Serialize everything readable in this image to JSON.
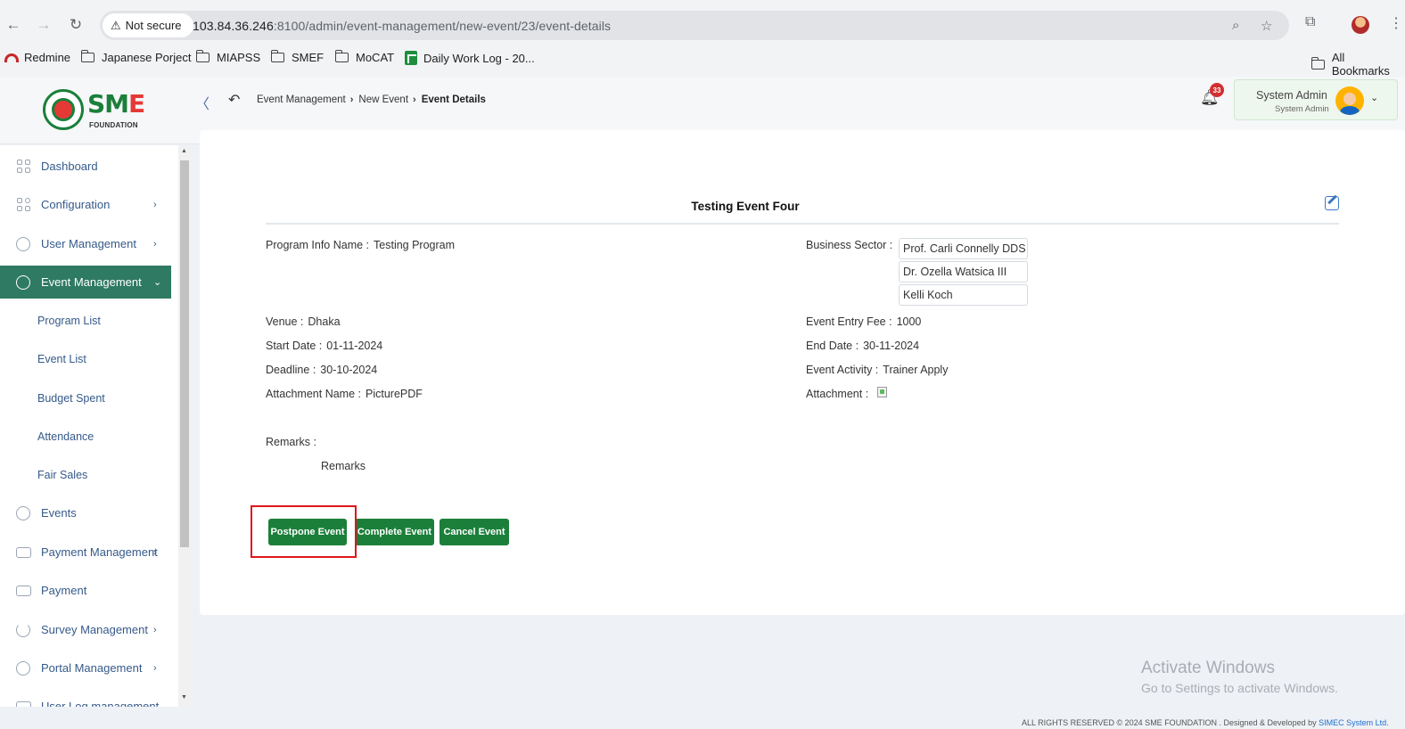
{
  "browser": {
    "security_label": "Not secure",
    "url_host": "103.84.36.246",
    "url_path": ":8100/admin/event-management/new-event/23/event-details",
    "bookmarks": [
      {
        "label": "Redmine",
        "icon": "redmine-icon"
      },
      {
        "label": "Japanese Porject",
        "icon": "folder-icon"
      },
      {
        "label": "MIAPSS",
        "icon": "folder-icon"
      },
      {
        "label": "SMEF",
        "icon": "folder-icon"
      },
      {
        "label": "MoCAT",
        "icon": "folder-icon"
      },
      {
        "label": "Daily Work Log - 20...",
        "icon": "sheets-icon"
      }
    ],
    "all_bookmarks_label": "All Bookmarks"
  },
  "header": {
    "logo_text_sm": "SM",
    "logo_text_e": "E",
    "logo_sub": "FOUNDATION",
    "breadcrumb": [
      "Event Management",
      "New Event",
      "Event Details"
    ],
    "notification_count": "33",
    "user_name": "System Admin",
    "user_role": "System Admin"
  },
  "sidebar": {
    "items": [
      {
        "label": "Dashboard",
        "icon": "dashboard-icon"
      },
      {
        "label": "Configuration",
        "icon": "configuration-icon"
      },
      {
        "label": "User Management",
        "icon": "user-management-icon"
      },
      {
        "label": "Event Management",
        "icon": "event-management-icon"
      },
      {
        "label": "Events",
        "icon": "events-icon"
      },
      {
        "label": "Payment Management",
        "icon": "payment-management-icon"
      },
      {
        "label": "Payment",
        "icon": "payment-icon"
      },
      {
        "label": "Survey Management",
        "icon": "survey-management-icon"
      },
      {
        "label": "Portal Management",
        "icon": "portal-management-icon"
      },
      {
        "label": "User Log management",
        "icon": "user-log-icon"
      }
    ],
    "event_sub_items": [
      "Program List",
      "Event List",
      "Budget Spent",
      "Attendance",
      "Fair Sales"
    ]
  },
  "event": {
    "title": "Testing Event Four",
    "program_info_label": "Program Info Name :",
    "program_info_value": "Testing Program",
    "business_sector_label": "Business Sector :",
    "business_sectors": [
      "Prof. Carli Connelly DDS",
      "Dr. Ozella Watsica III",
      "Kelli Koch"
    ],
    "venue_label": "Venue :",
    "venue_value": "Dhaka",
    "entry_fee_label": "Event Entry Fee :",
    "entry_fee_value": "1000",
    "start_date_label": "Start Date :",
    "start_date_value": "01-11-2024",
    "end_date_label": "End Date :",
    "end_date_value": "30-11-2024",
    "deadline_label": "Deadline :",
    "deadline_value": "30-10-2024",
    "activity_label": "Event Activity :",
    "activity_value": "Trainer Apply",
    "attachment_name_label": "Attachment Name :",
    "attachment_name_value": "PicturePDF",
    "attachment_label": "Attachment :",
    "remarks_label": "Remarks :",
    "remarks_value": "Remarks"
  },
  "actions": {
    "postpone": "Postpone Event",
    "complete": "Complete Event",
    "cancel": "Cancel Event"
  },
  "watermark": {
    "line1": "Activate Windows",
    "line2": "Go to Settings to activate Windows."
  },
  "footer": {
    "rights": "ALL RIGHTS RESERVED © 2024 SME FOUNDATION . Designed & Developed by",
    "developer": "SIMEC System Ltd."
  },
  "colors": {
    "brand_green": "#1b7f3a",
    "sidebar_active": "#2f7a62",
    "highlight_red": "#e0161b",
    "badge_red": "#d32f2f"
  }
}
